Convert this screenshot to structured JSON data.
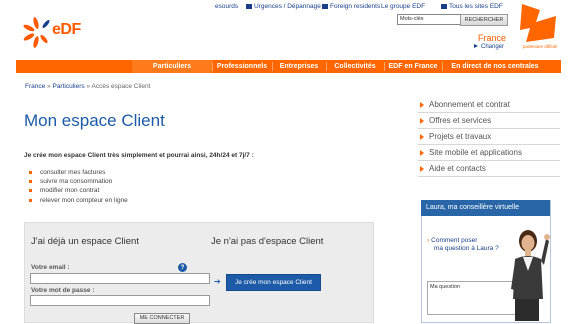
{
  "header": {
    "top_links": [
      {
        "label": "esourds",
        "icon": "none"
      },
      {
        "label": "Urgences / Dépannage",
        "icon": "alert-icon"
      },
      {
        "label": "Foreign residents",
        "icon": "globe-icon"
      },
      {
        "label": "Le groupe EDF",
        "icon": "none"
      },
      {
        "label": "Tous les sites EDF",
        "icon": "sites-icon"
      }
    ],
    "logo_text": "eDF",
    "search_value": "Mots-clés",
    "search_button": "RECHERCHER",
    "country": "France",
    "change_label": "Changer",
    "london_tagline": "partenaire officiel"
  },
  "nav": {
    "items": [
      "Particuliers",
      "Professionnels",
      "Entreprises",
      "Collectivités",
      "EDF en France",
      "En direct de nos centrales"
    ]
  },
  "breadcrumb": {
    "items": [
      "France",
      "Particuliers",
      "Accès espace Client"
    ],
    "separator": "»"
  },
  "main": {
    "title": "Mon espace Client",
    "intro": "Je crée mon espace Client très simplement et pourrai ainsi, 24h/24 et 7j/7 :",
    "bullets": [
      "consulter mes factures",
      "suivre ma consommation",
      "modifier mon contrat",
      "relever mon compteur en ligne"
    ]
  },
  "login": {
    "title": "J'ai déjà un espace Client",
    "email_label": "Votre email :",
    "password_label": "Votre mot de passe :",
    "connect_button": "ME CONNECTER",
    "help_glyph": "?"
  },
  "register": {
    "title": "Je n'ai pas d'espace Client",
    "button": "Je crée mon espace Client"
  },
  "right_menu": {
    "items": [
      "Abonnement et contrat",
      "Offres et services",
      "Projets et travaux",
      "Site mobile et applications",
      "Aide et contacts"
    ]
  },
  "laura": {
    "title": "Laura, ma conseillère virtuelle",
    "link_line1": "Comment poser",
    "link_line2": "ma question à Laura ?",
    "question_placeholder": "Ma question"
  },
  "colors": {
    "brand_orange": "#ff6600",
    "brand_blue": "#1d5aa8"
  }
}
